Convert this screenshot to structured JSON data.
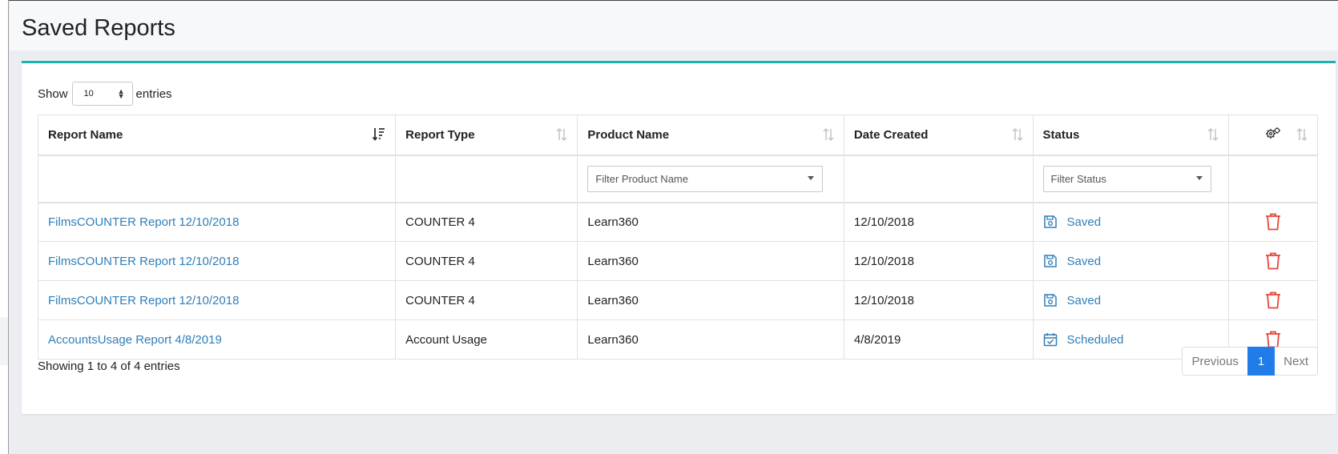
{
  "page": {
    "title": "Saved Reports"
  },
  "length_menu": {
    "prefix": "Show",
    "value": "10",
    "suffix": "entries"
  },
  "columns": [
    "Report Name",
    "Report Type",
    "Product Name",
    "Date Created",
    "Status"
  ],
  "filters": {
    "product_placeholder": "Filter Product Name",
    "status_placeholder": "Filter Status"
  },
  "rows": [
    {
      "name": "FilmsCOUNTER Report 12/10/2018",
      "type": "COUNTER 4",
      "product": "Learn360",
      "date": "12/10/2018",
      "status": "Saved",
      "status_icon": "save-icon"
    },
    {
      "name": "FilmsCOUNTER Report 12/10/2018",
      "type": "COUNTER 4",
      "product": "Learn360",
      "date": "12/10/2018",
      "status": "Saved",
      "status_icon": "save-icon"
    },
    {
      "name": "FilmsCOUNTER Report 12/10/2018",
      "type": "COUNTER 4",
      "product": "Learn360",
      "date": "12/10/2018",
      "status": "Saved",
      "status_icon": "save-icon"
    },
    {
      "name": "AccountsUsage Report 4/8/2019",
      "type": "Account Usage",
      "product": "Learn360",
      "date": "4/8/2019",
      "status": "Scheduled",
      "status_icon": "calendar-check-icon"
    }
  ],
  "footer": {
    "info": "Showing 1 to 4 of 4 entries"
  },
  "pagination": {
    "previous": "Previous",
    "current": "1",
    "next": "Next"
  },
  "colors": {
    "accent": "#1db4b0",
    "link": "#2f7fb8",
    "delete": "#e8463a",
    "page_active": "#1f7ce8"
  }
}
